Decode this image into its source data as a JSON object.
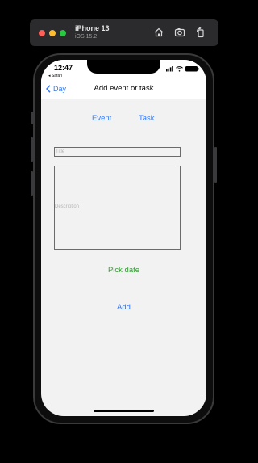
{
  "simulator": {
    "device_name": "iPhone 13",
    "os_version": "iOS 15.2",
    "icons": [
      "home-icon",
      "screenshot-icon",
      "rotate-icon"
    ]
  },
  "status_bar": {
    "time": "12:47",
    "back_to_app": "◂ Safari"
  },
  "nav": {
    "back_label": "Day",
    "title": "Add event or task"
  },
  "segments": {
    "event": "Event",
    "task": "Task"
  },
  "form": {
    "title_placeholder": "Title",
    "description_placeholder": "Description",
    "pick_date_label": "Pick date",
    "add_label": "Add"
  },
  "colors": {
    "accent": "#3478f6",
    "pick_date": "#2f9e2f",
    "background": "#f2f2f2"
  }
}
